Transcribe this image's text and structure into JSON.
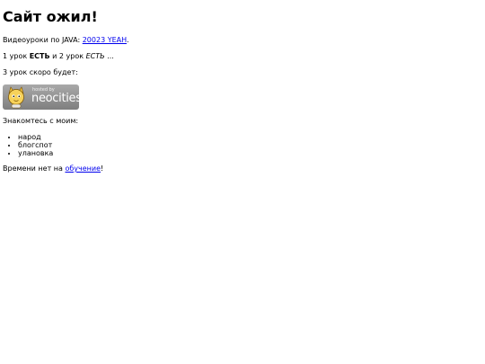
{
  "page": {
    "title": "Сайт ожил!"
  },
  "video_line": {
    "prefix": "Видеоуроки по JAVA: ",
    "link_text": "20023 YEAH",
    "suffix": "."
  },
  "lessons_line": {
    "part1": "1 урок ",
    "bold": "ЕСТЬ",
    "part2": " и 2 урок ",
    "italic": "ЕСТЬ",
    "part3": " ..."
  },
  "lesson3_line": {
    "text": "3 урок скоро будет:"
  },
  "badge": {
    "hosted_text": "hosted by",
    "brand_text": "neocities"
  },
  "intro_line": {
    "text": "Знакомтесь с моим:"
  },
  "list": {
    "items": [
      "народ",
      "блогспот",
      "улановка"
    ]
  },
  "footer_line": {
    "prefix": "Времени нет на ",
    "link_text": "обучение",
    "suffix": "!"
  }
}
